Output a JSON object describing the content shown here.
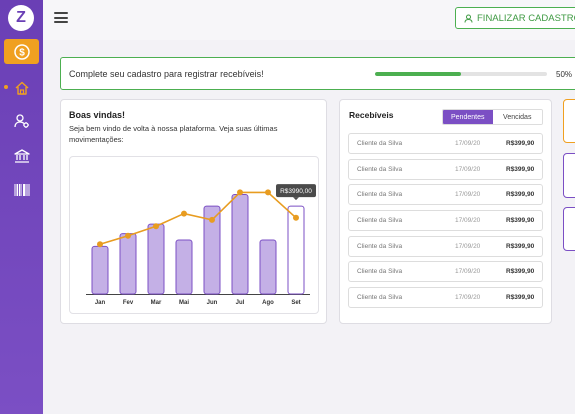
{
  "sidebar": {
    "logo": "Z",
    "items": [
      {
        "name": "coin-icon",
        "active": true
      },
      {
        "name": "home-icon",
        "active": false
      },
      {
        "name": "user-settings-icon",
        "active": false
      },
      {
        "name": "bank-icon",
        "active": false
      },
      {
        "name": "barcode-icon",
        "active": false
      }
    ]
  },
  "header": {
    "menu_icon": "hamburger-menu-icon",
    "finalize_label": "FINALIZAR CADASTRO",
    "finalize_icon": "user-icon"
  },
  "banner": {
    "text": "Complete seu cadastro para registrar recebíveis!",
    "progress": 0.5,
    "progress_label": "50%"
  },
  "welcome": {
    "title": "Boas vindas!",
    "subtitle": "Seja bem vindo de volta à nossa plataforma. Veja suas últimas movimentações:"
  },
  "chart_data": {
    "type": "bar",
    "categories": [
      "Jan",
      "Fev",
      "Mar",
      "Mai",
      "Jun",
      "Jul",
      "Ago",
      "Set"
    ],
    "bar_values": [
      45,
      57,
      66,
      51,
      83,
      94,
      51,
      83
    ],
    "line_values": [
      47,
      55,
      64,
      76,
      70,
      96,
      96,
      72
    ],
    "ylim": [
      0,
      120
    ],
    "tooltip": {
      "index": 7,
      "label": "R$3990,00"
    },
    "colors": {
      "bar_fill": "#c4b0e6",
      "bar_stroke": "#7b4fc4",
      "bar_highlight_fill": "#ffffff",
      "line": "#e89c20"
    }
  },
  "receivables": {
    "title": "Recebíveis",
    "tabs": [
      {
        "label": "Pendentes",
        "active": true
      },
      {
        "label": "Vencidas",
        "active": false
      }
    ],
    "rows": [
      {
        "name": "Cliente da Silva",
        "date": "17/09/20",
        "amount": "R$399,90"
      },
      {
        "name": "Cliente da Silva",
        "date": "17/09/20",
        "amount": "R$399,90"
      },
      {
        "name": "Cliente da Silva",
        "date": "17/09/20",
        "amount": "R$399,90"
      },
      {
        "name": "Cliente da Silva",
        "date": "17/09/20",
        "amount": "R$399,90"
      },
      {
        "name": "Cliente da Silva",
        "date": "17/09/20",
        "amount": "R$399,90"
      },
      {
        "name": "Cliente da Silva",
        "date": "17/09/20",
        "amount": "R$399,90"
      },
      {
        "name": "Cliente da Silva",
        "date": "17/09/20",
        "amount": "R$399,90"
      }
    ]
  },
  "colors": {
    "brand_purple": "#6a3fb5",
    "accent_orange": "#f0a020",
    "success_green": "#4caf50"
  }
}
